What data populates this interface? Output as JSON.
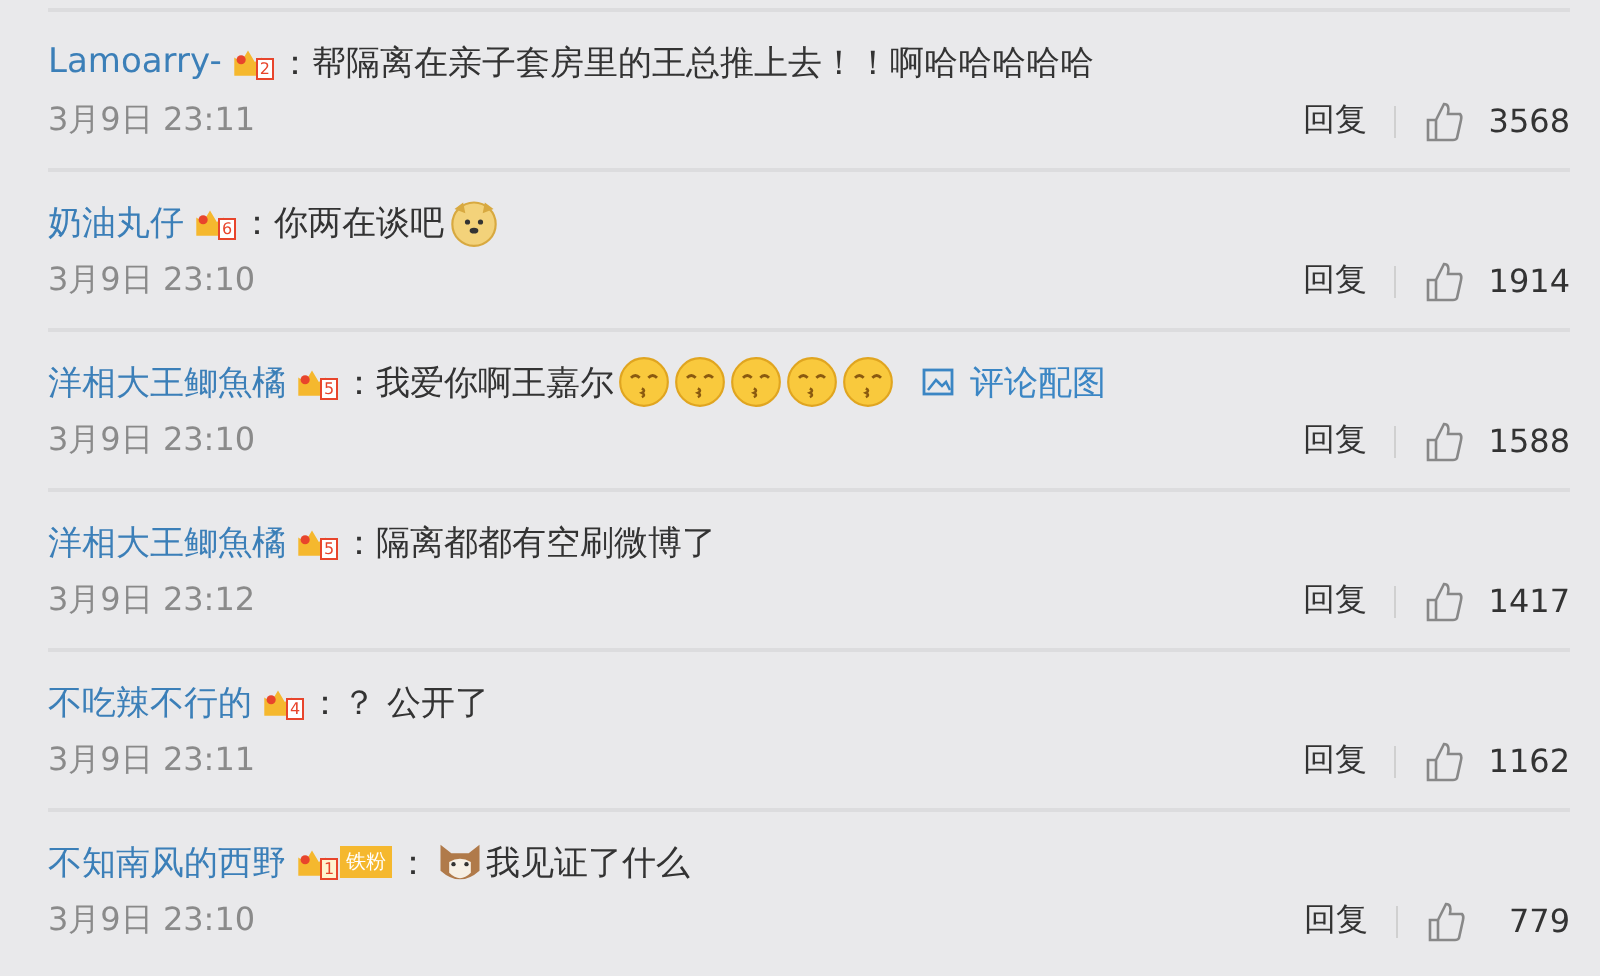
{
  "comments": [
    {
      "user": "Lamoarry-",
      "badge": {
        "kind": "level",
        "level": "2"
      },
      "colon": "：",
      "parts": [
        {
          "kind": "text",
          "text": "帮隔离在亲子套房里的王总推上去！！啊哈哈哈哈哈"
        }
      ],
      "date": "3月9日 23:11",
      "reply": "回复",
      "likes": "3568"
    },
    {
      "user": "奶油丸仔",
      "badge": {
        "kind": "level",
        "level": "6"
      },
      "colon": "：",
      "parts": [
        {
          "kind": "text",
          "text": "你两在谈吧"
        },
        {
          "kind": "doge"
        }
      ],
      "date": "3月9日 23:10",
      "reply": "回复",
      "likes": "1914"
    },
    {
      "user": "洋相大王鲫魚橘",
      "badge": {
        "kind": "level",
        "level": "5"
      },
      "colon": "：",
      "parts": [
        {
          "kind": "text",
          "text": "我爱你啊王嘉尔"
        },
        {
          "kind": "kiss"
        },
        {
          "kind": "kiss"
        },
        {
          "kind": "kiss"
        },
        {
          "kind": "kiss"
        },
        {
          "kind": "kiss"
        }
      ],
      "image_link": "评论配图",
      "date": "3月9日 23:10",
      "reply": "回复",
      "likes": "1588"
    },
    {
      "user": "洋相大王鲫魚橘",
      "badge": {
        "kind": "level",
        "level": "5"
      },
      "colon": "：",
      "parts": [
        {
          "kind": "text",
          "text": "隔离都都有空刷微博了"
        }
      ],
      "date": "3月9日 23:12",
      "reply": "回复",
      "likes": "1417"
    },
    {
      "user": "不吃辣不行的",
      "badge": {
        "kind": "level",
        "level": "4"
      },
      "colon": "：",
      "parts": [
        {
          "kind": "text",
          "text": "？ 公开了"
        }
      ],
      "date": "3月9日 23:11",
      "reply": "回复",
      "likes": "1162"
    },
    {
      "user": "不知南风的西野",
      "badge": {
        "kind": "fan",
        "level": "1",
        "label": "铁粉"
      },
      "colon": "：",
      "parts": [
        {
          "kind": "cat"
        },
        {
          "kind": "text",
          "text": "我见证了什么"
        }
      ],
      "date": "3月9日 23:10",
      "reply": "回复",
      "likes": "779"
    }
  ]
}
